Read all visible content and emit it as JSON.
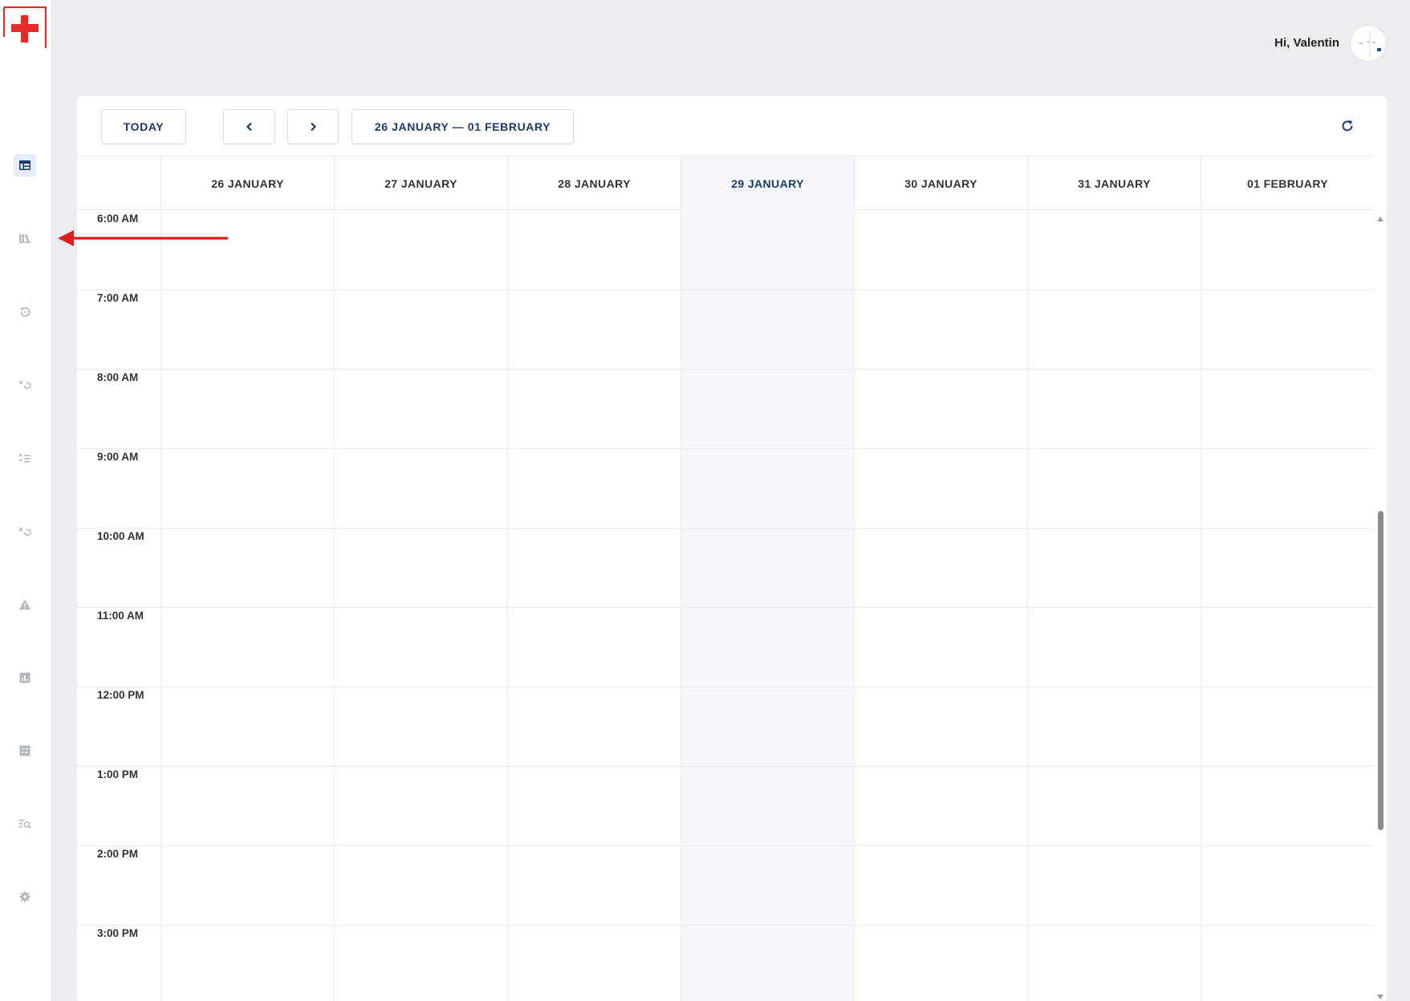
{
  "header": {
    "greeting": "Hi, Valentin"
  },
  "sidebar": {
    "items": [
      {
        "icon": "calendar-table-icon",
        "active": true
      },
      {
        "icon": "library-icon",
        "active": false
      },
      {
        "icon": "history-icon",
        "active": false
      },
      {
        "icon": "cancel-history-icon",
        "active": false
      },
      {
        "icon": "checklist-icon",
        "active": false
      },
      {
        "icon": "cancel-history-icon",
        "active": false
      },
      {
        "icon": "warning-icon",
        "active": false
      },
      {
        "icon": "bar-chart-icon",
        "active": false
      },
      {
        "icon": "report-icon",
        "active": false
      },
      {
        "icon": "search-list-icon",
        "active": false
      },
      {
        "icon": "gear-icon",
        "active": false
      }
    ]
  },
  "toolbar": {
    "today_label": "TODAY",
    "date_range": "26 JANUARY — 01 FEBRUARY"
  },
  "calendar": {
    "days": [
      "26 JANUARY",
      "27 JANUARY",
      "28 JANUARY",
      "29 JANUARY",
      "30 JANUARY",
      "31 JANUARY",
      "01 FEBRUARY"
    ],
    "today_index": 3,
    "times": [
      "6:00 AM",
      "7:00 AM",
      "8:00 AM",
      "9:00 AM",
      "10:00 AM",
      "11:00 AM",
      "12:00 PM",
      "1:00 PM",
      "2:00 PM",
      "3:00 PM"
    ]
  },
  "colors": {
    "accent": "#1b3a6b",
    "logo_red": "#e32b2b",
    "annotation_red": "#e01b1b",
    "today_column": "#f4f6f9"
  }
}
